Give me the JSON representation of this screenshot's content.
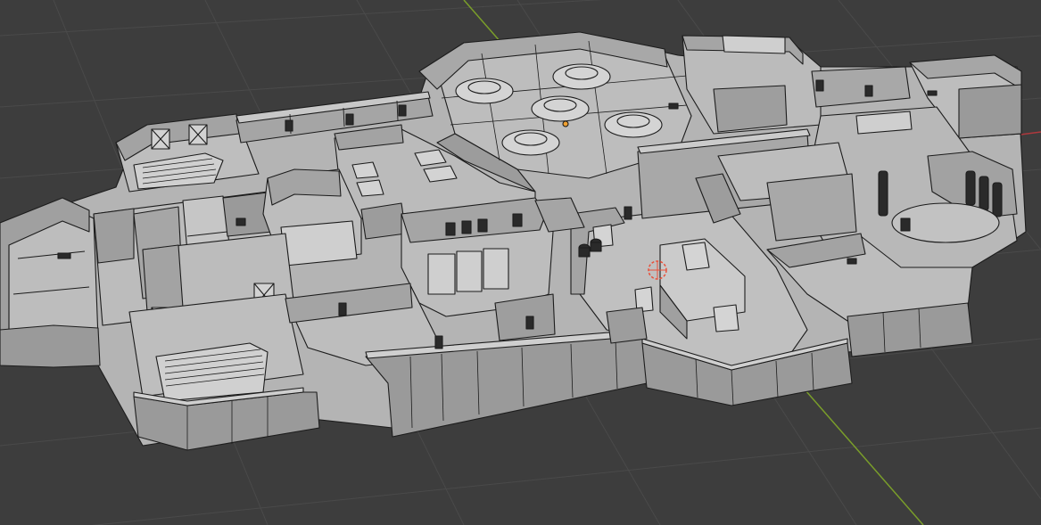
{
  "viewport": {
    "background_color": "#3d3d3d",
    "grid_color": "#4a4a4a",
    "x_axis_color": "#b0383d",
    "y_axis_color": "#7a9e2a",
    "floor_color": "#b4b4b4",
    "wall_top_color": "#cfcfcf",
    "wall_face_color": "#9a9a9a",
    "edge_color": "#1c1c1c",
    "selected_color": "#e8503a",
    "origin_color": "#f0a030",
    "icons": [
      "3d-cursor-icon",
      "object-origin-icon"
    ]
  }
}
